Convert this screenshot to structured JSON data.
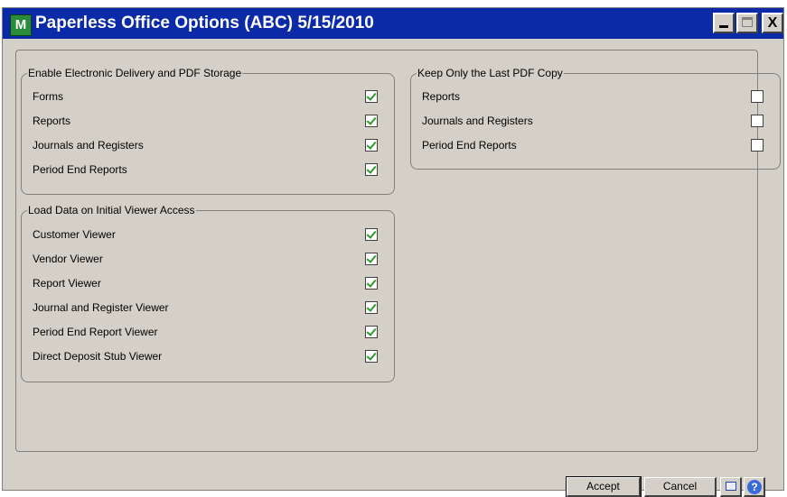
{
  "window": {
    "title": "Paperless Office Options (ABC) 5/15/2010",
    "app_icon_glyph": "M",
    "minimize_glyph": "_",
    "maximize_glyph": "□",
    "close_glyph": "X"
  },
  "group_enable": {
    "legend": "Enable Electronic Delivery and PDF Storage",
    "items": [
      {
        "label": "Forms",
        "checked": true
      },
      {
        "label": "Reports",
        "checked": true
      },
      {
        "label": "Journals and Registers",
        "checked": true
      },
      {
        "label": "Period End Reports",
        "checked": true
      }
    ]
  },
  "group_keep": {
    "legend": "Keep Only the Last PDF Copy",
    "items": [
      {
        "label": "Reports",
        "checked": false
      },
      {
        "label": "Journals and Registers",
        "checked": false
      },
      {
        "label": "Period End Reports",
        "checked": false
      }
    ]
  },
  "group_load": {
    "legend": "Load Data on Initial Viewer Access",
    "items": [
      {
        "label": "Customer Viewer",
        "checked": true
      },
      {
        "label": "Vendor Viewer",
        "checked": true
      },
      {
        "label": "Report Viewer",
        "checked": true
      },
      {
        "label": "Journal and Register Viewer",
        "checked": true
      },
      {
        "label": "Period End Report Viewer",
        "checked": true
      },
      {
        "label": "Direct Deposit Stub Viewer",
        "checked": true
      }
    ]
  },
  "buttons": {
    "accept_label": "Accept",
    "cancel_label": "Cancel",
    "print_icon": "printer-icon",
    "help_icon": "help-icon",
    "help_glyph": "?"
  },
  "colors": {
    "title_bar": "#0a2aa8",
    "window_bg": "#d4d0c8",
    "check_mark": "#2e9a2e"
  }
}
